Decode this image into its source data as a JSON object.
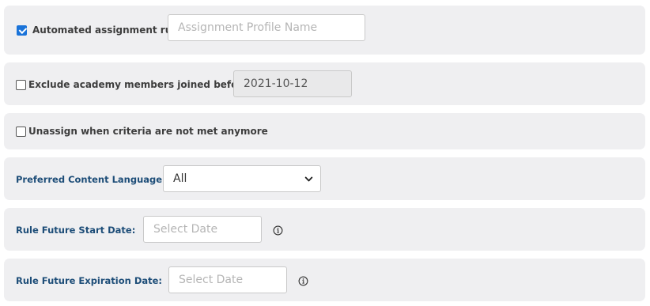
{
  "automated_rule": {
    "label": "Automated assignment rule",
    "checked": true,
    "profile_name_placeholder": "Assignment Profile Name",
    "profile_name_value": ""
  },
  "exclude_members": {
    "label": "Exclude academy members joined before",
    "checked": false,
    "date_value": "2021-10-12"
  },
  "unassign": {
    "label": "Unassign when criteria are not met anymore",
    "checked": false
  },
  "content_language": {
    "label": "Preferred Content Language:",
    "selected": "All"
  },
  "future_start": {
    "label": "Rule Future Start Date:",
    "placeholder": "Select Date"
  },
  "future_expiration": {
    "label": "Rule Future Expiration Date:",
    "placeholder": "Select Date"
  },
  "colors": {
    "panel_bg": "#efeff1",
    "checkbox_accent": "#1a73d9",
    "label_blue": "#1d4d78"
  }
}
